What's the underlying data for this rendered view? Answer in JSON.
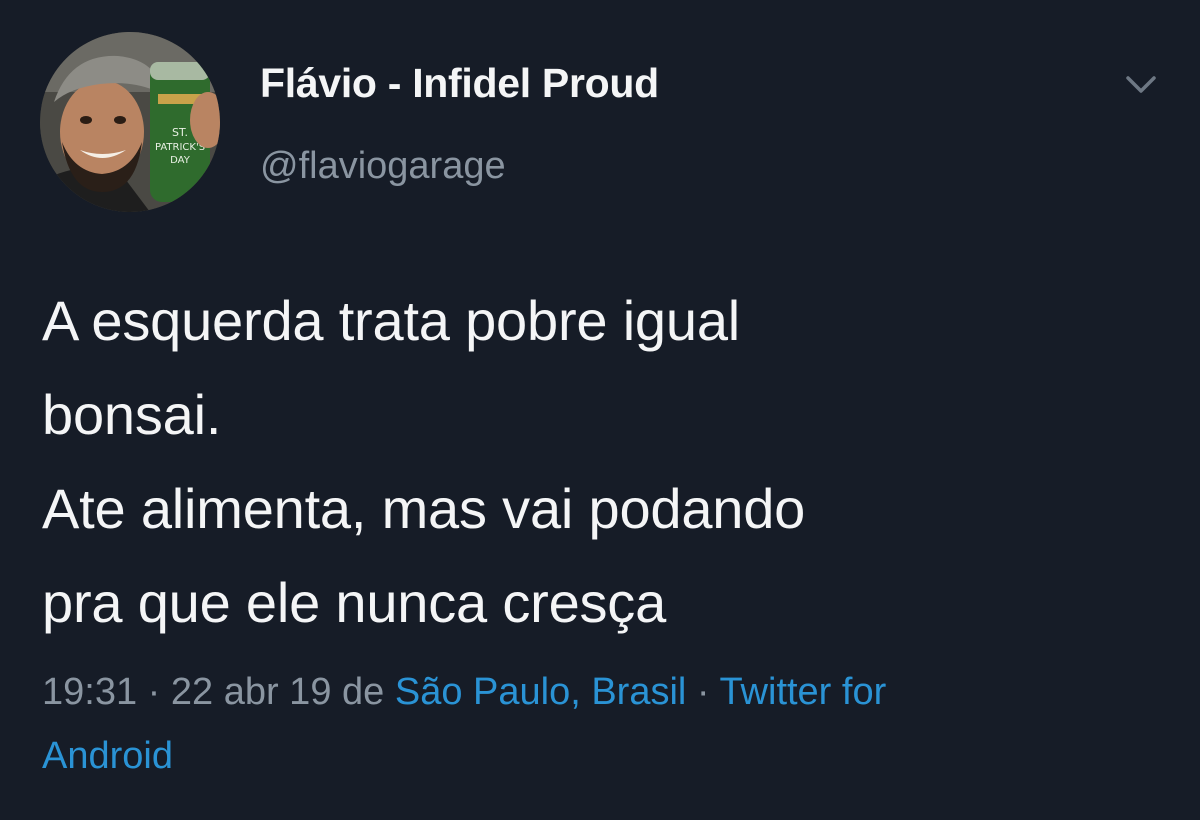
{
  "colors": {
    "background": "#161c27",
    "text_primary": "#f4f5f6",
    "text_secondary": "#8a95a1",
    "link": "#2a93d5"
  },
  "tweet": {
    "author": {
      "display_name": "Flávio - Infidel Proud",
      "handle": "@flaviogarage",
      "avatar": "profile-photo-avatar",
      "avatar_can_text": [
        "ST.",
        "PATRICK'S",
        "DAY"
      ]
    },
    "menu_icon": "chevron-down-icon",
    "text_lines": [
      "A esquerda trata pobre igual",
      "bonsai.",
      "Ate alimenta, mas vai podando",
      "pra que ele nunca cresça"
    ],
    "meta": {
      "time": "19:31",
      "separator": " · ",
      "date": "22 abr 19",
      "from_prefix": " de ",
      "location": "São Paulo, Brasil",
      "source_line1": "Twitter for",
      "source_line2": "Android"
    }
  }
}
